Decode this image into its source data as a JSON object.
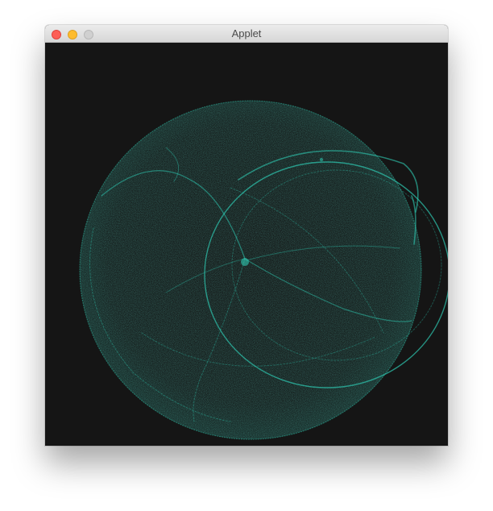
{
  "window": {
    "title": "Applet",
    "buttons": {
      "close": "close-icon",
      "minimize": "minimize-icon",
      "maximize": "maximize-icon"
    }
  },
  "canvas": {
    "background_color": "#151515",
    "stroke_color": "#2ec9b2"
  }
}
